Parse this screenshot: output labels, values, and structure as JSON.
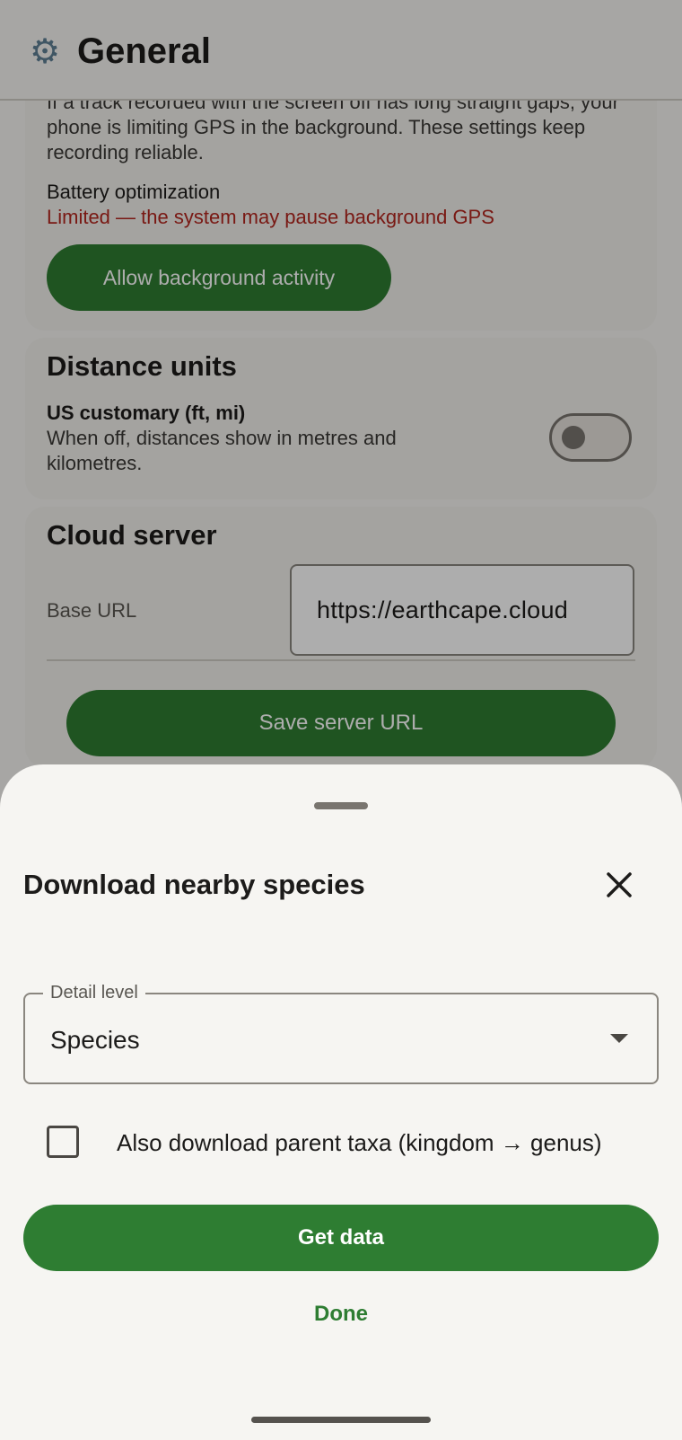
{
  "header": {
    "icon": "gear-icon",
    "title": "General"
  },
  "background_activity": {
    "intro": "If a track recorded with the screen off has long straight gaps, your phone is limiting GPS in the background. These settings keep recording reliable.",
    "battery_label": "Battery optimization",
    "battery_status": "Limited — the system may pause background GPS",
    "allow_button": "Allow background activity"
  },
  "distance_units": {
    "title": "Distance units",
    "setting_label": "US customary (ft, mi)",
    "setting_description": "When off, distances show in metres and kilometres.",
    "enabled": false
  },
  "cloud_server": {
    "title": "Cloud server",
    "url_label": "Base URL",
    "url_value": "https://earthcape.cloud",
    "save_button": "Save server URL"
  },
  "sheet": {
    "title": "Download nearby species",
    "detail_level": {
      "label": "Detail level",
      "value": "Species"
    },
    "parent_taxa": {
      "label": "Also download parent taxa (kingdom → genus)",
      "checked": false
    },
    "get_button": "Get data",
    "done_button": "Done"
  },
  "colors": {
    "primary": "#2e7d32",
    "error": "#b3261e",
    "surface": "#f6f5f2"
  }
}
